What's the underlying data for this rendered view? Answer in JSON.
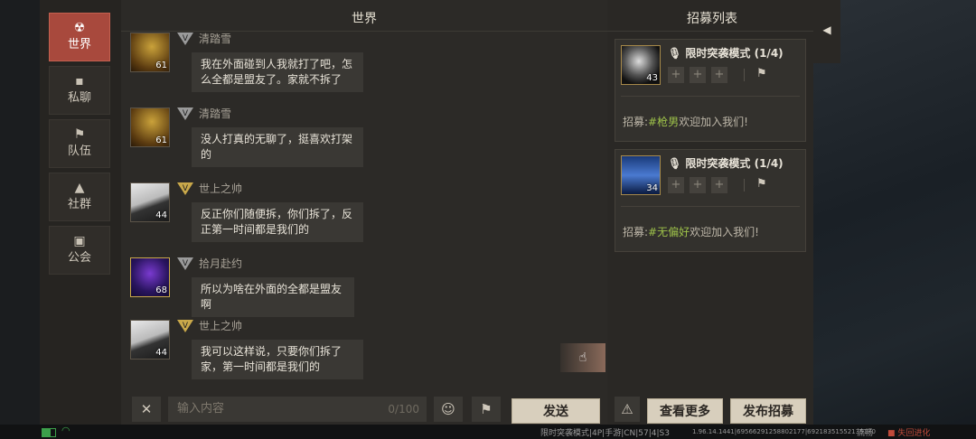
{
  "left_tabs": [
    {
      "label": "世界",
      "icon": "world-icon",
      "active": true
    },
    {
      "label": "私聊",
      "icon": "chat-bubble-icon",
      "active": false
    },
    {
      "label": "队伍",
      "icon": "flag-icon",
      "active": false
    },
    {
      "label": "社群",
      "icon": "campfire-icon",
      "active": false
    },
    {
      "label": "公会",
      "icon": "guild-banner-icon",
      "active": false
    }
  ],
  "chat": {
    "title": "世界",
    "messages": [
      {
        "name": "清踏雪",
        "level": "61",
        "badge": "V",
        "badge_color": "grey",
        "text": "我在外面碰到人我就打了吧，怎么全都是盟友了。家就不拆了"
      },
      {
        "name": "清踏雪",
        "level": "61",
        "badge": "V",
        "badge_color": "grey",
        "text": "没人打真的无聊了，挺喜欢打架的"
      },
      {
        "name": "世上之帅",
        "level": "44",
        "badge": "V",
        "badge_color": "gold",
        "text": "反正你们随便拆，你们拆了，反正第一时间都是我们的"
      },
      {
        "name": "拾月赴约",
        "level": "68",
        "badge": "V",
        "badge_color": "grey",
        "text": "所以为啥在外面的全都是盟友啊"
      },
      {
        "name": "世上之帅",
        "level": "44",
        "badge": "V",
        "badge_color": "gold",
        "text": "我可以这样说，只要你们拆了家，第一时间都是我们的"
      }
    ]
  },
  "input": {
    "placeholder": "输入内容",
    "counter": "0/100"
  },
  "send_label": "发送",
  "recruit": {
    "title": "招募列表",
    "cards": [
      {
        "level": "43",
        "mode": "限时突袭模式 (1/4)",
        "prefix": "招募:",
        "tag": "#枪男",
        "suffix": "欢迎加入我们!"
      },
      {
        "level": "34",
        "mode": "限时突袭模式 (1/4)",
        "prefix": "招募:",
        "tag": "#无偏好",
        "suffix": "欢迎加入我们!"
      }
    ],
    "more_label": "查看更多",
    "publish_label": "发布招募"
  },
  "status": {
    "server": "限时突袭模式|4P|手游|CN|57|4|S3",
    "build": "1.96.14.1441|69566291258802177|69218351552135170",
    "quality": "流畅",
    "brand": "失回进化"
  },
  "colors": {
    "active_tab": "#a8493d",
    "tag_green": "#9ec24a",
    "panel": "#2c2a27"
  }
}
